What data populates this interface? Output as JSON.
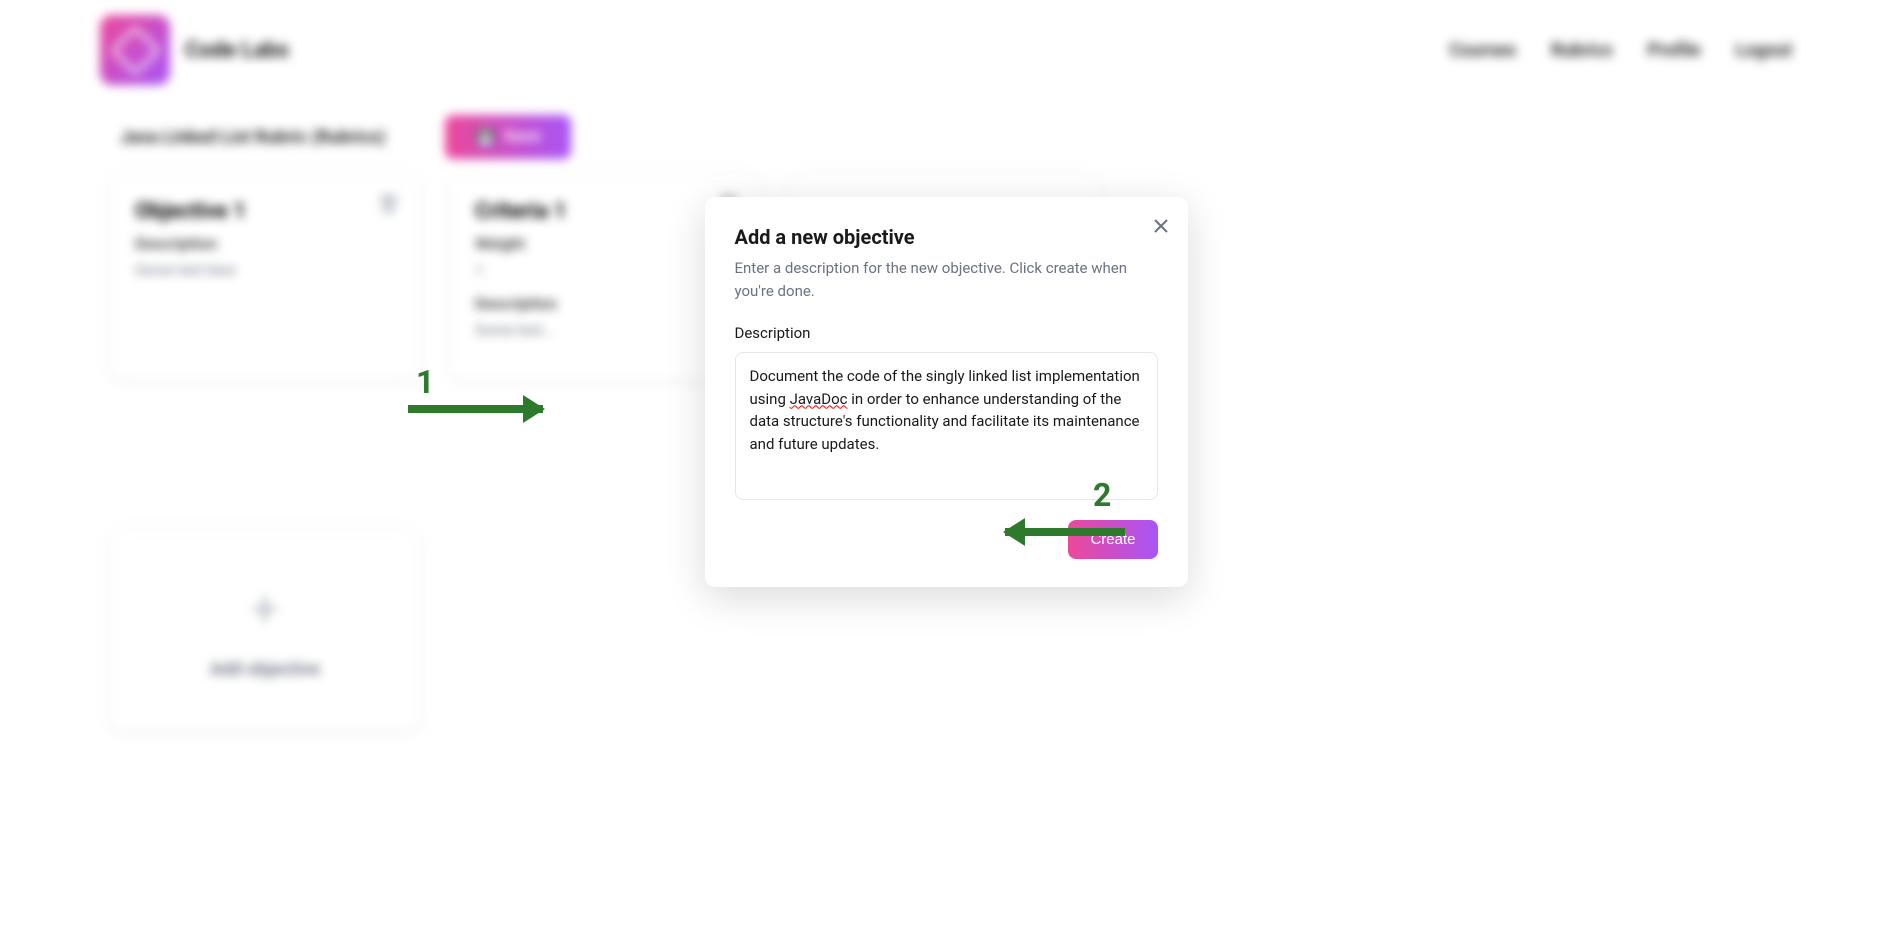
{
  "header": {
    "brand": "Code Labs",
    "nav": [
      "Courses",
      "Rubrics",
      "Profile",
      "Logout"
    ]
  },
  "subheader": {
    "breadcrumb": "Java Linked List Rubric (Rubrics)",
    "save_label": "Save"
  },
  "background": {
    "objective": {
      "title": "Objective 1",
      "desc_label": "Description",
      "desc_value": "Some text here"
    },
    "criteria": {
      "title": "Criteria 1",
      "weight_label": "Weight",
      "weight_value": "1",
      "desc_label": "Description",
      "desc_value": "Some text..."
    },
    "add_objective": "Add objective"
  },
  "modal": {
    "title": "Add a new objective",
    "subtitle": "Enter a description for the new objective. Click create when you're done.",
    "field_label": "Description",
    "textarea_value_parts": {
      "before": "Document the code of the singly linked list implementation using ",
      "misspelled": "JavaDoc",
      "after": " in order to enhance understanding of the data structure's functionality and facilitate its maintenance and future updates."
    },
    "create_label": "Create"
  },
  "annotations": {
    "label1": "1",
    "label2": "2"
  }
}
